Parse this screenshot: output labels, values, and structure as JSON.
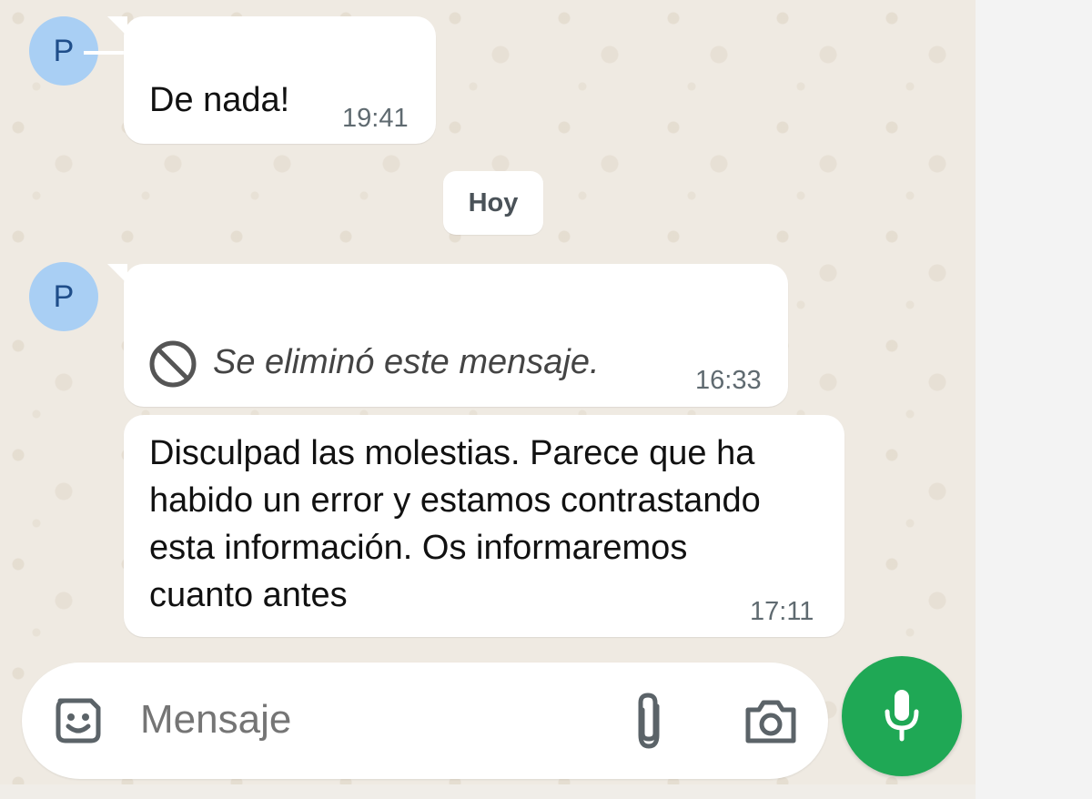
{
  "messages": [
    {
      "avatar_letter": "P",
      "text": "De nada!",
      "time": "19:41"
    },
    {
      "avatar_letter": "P",
      "text": "Se eliminó este mensaje.",
      "time": "16:33",
      "deleted": true
    },
    {
      "text": "Disculpad las molestias. Parece que ha habido un error y estamos contrastando esta información. Os informaremos cuanto antes",
      "time": "17:11"
    }
  ],
  "date_separator": "Hoy",
  "composer": {
    "placeholder": "Mensaje"
  },
  "icons": {
    "sticker": "sticker-smiley-icon",
    "attach": "paperclip-icon",
    "camera": "camera-icon",
    "mic": "microphone-icon",
    "deleted": "prohibited-icon"
  },
  "colors": {
    "mic_button": "#1FA855",
    "avatar_bg": "#A9CFF4",
    "avatar_text": "#1F4E8A",
    "chat_bg": "#EFEAE2"
  }
}
